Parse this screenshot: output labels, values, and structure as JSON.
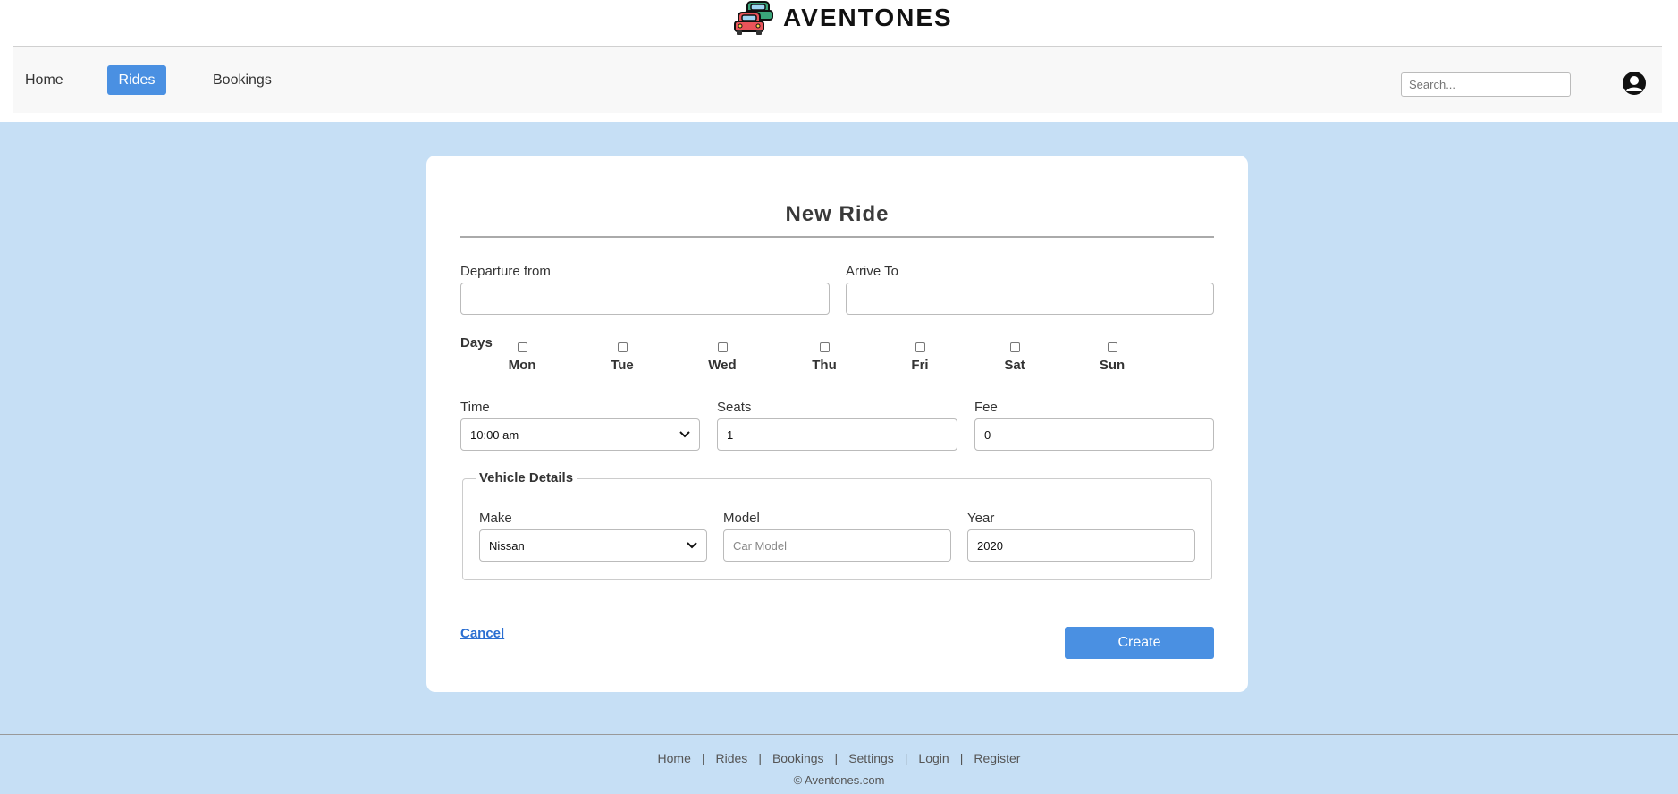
{
  "brand": {
    "name": "AVENTONES",
    "logo_icon": "cars-icon"
  },
  "nav": {
    "items": [
      {
        "label": "Home"
      },
      {
        "label": "Rides",
        "active": true
      },
      {
        "label": "Bookings"
      }
    ],
    "search_placeholder": "Search...",
    "accent": "#4a90e2"
  },
  "form": {
    "title": "New Ride",
    "departure_label": "Departure from",
    "departure_value": "",
    "arrive_label": "Arrive To",
    "arrive_value": "",
    "days_label": "Days",
    "days": [
      "Mon",
      "Tue",
      "Wed",
      "Thu",
      "Fri",
      "Sat",
      "Sun"
    ],
    "time_label": "Time",
    "time_value": "10:00 am",
    "seats_label": "Seats",
    "seats_value": "1",
    "fee_label": "Fee",
    "fee_value": "0",
    "vehicle": {
      "legend": "Vehicle Details",
      "make_label": "Make",
      "make_value": "Nissan",
      "model_label": "Model",
      "model_placeholder": "Car Model",
      "year_label": "Year",
      "year_value": "2020"
    },
    "cancel_label": "Cancel",
    "create_label": "Create"
  },
  "footer": {
    "links": [
      "Home",
      "Rides",
      "Bookings",
      "Settings",
      "Login",
      "Register"
    ],
    "copyright": "© Aventones.com"
  }
}
